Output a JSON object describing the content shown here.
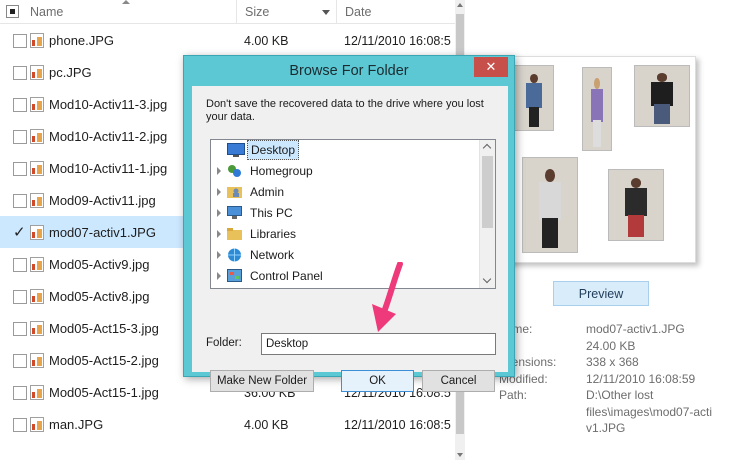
{
  "file_list": {
    "headers": {
      "name": "Name",
      "size": "Size",
      "date": "Date"
    },
    "rows": [
      {
        "name": "phone.JPG",
        "size": "4.00 KB",
        "date": "12/11/2010 16:08:5",
        "checked": false
      },
      {
        "name": "pc.JPG",
        "size": "",
        "date": "",
        "checked": false
      },
      {
        "name": "Mod10-Activ11-3.jpg",
        "size": "",
        "date": "",
        "checked": false
      },
      {
        "name": "Mod10-Activ11-2.jpg",
        "size": "",
        "date": "",
        "checked": false
      },
      {
        "name": "Mod10-Activ11-1.jpg",
        "size": "",
        "date": "",
        "checked": false
      },
      {
        "name": "Mod09-Activ11.jpg",
        "size": "",
        "date": "",
        "checked": false
      },
      {
        "name": "mod07-activ1.JPG",
        "size": "",
        "date": "",
        "checked": true
      },
      {
        "name": "Mod05-Activ9.jpg",
        "size": "",
        "date": "",
        "checked": false
      },
      {
        "name": "Mod05-Activ8.jpg",
        "size": "",
        "date": "",
        "checked": false
      },
      {
        "name": "Mod05-Act15-3.jpg",
        "size": "",
        "date": "",
        "checked": false
      },
      {
        "name": "Mod05-Act15-2.jpg",
        "size": "",
        "date": "",
        "checked": false
      },
      {
        "name": "Mod05-Act15-1.jpg",
        "size": "36.00 KB",
        "date": "12/11/2010 16:08:5",
        "checked": false
      },
      {
        "name": "man.JPG",
        "size": "4.00 KB",
        "date": "12/11/2010 16:08:5",
        "checked": false
      }
    ]
  },
  "preview": {
    "button_label": "Preview",
    "properties": [
      {
        "label": "name:",
        "value": "mod07-activ1.JPG"
      },
      {
        "label": "e:",
        "value": "24.00 KB"
      },
      {
        "label": "imensions:",
        "value": "338 x 368"
      },
      {
        "label": "Modified:",
        "value": "12/11/2010 16:08:59"
      },
      {
        "label": "Path:",
        "value": "D:\\Other lost"
      },
      {
        "label": "",
        "value": "files\\images\\mod07-acti"
      },
      {
        "label": "",
        "value": "v1.JPG"
      }
    ]
  },
  "dialog": {
    "title": "Browse For Folder",
    "close_glyph": "✕",
    "message": "Don't save the recovered data to the drive where you lost your data.",
    "tree_items": [
      {
        "label": "Desktop",
        "icon": "desktop-icon",
        "selected": true,
        "expandable": false
      },
      {
        "label": "Homegroup",
        "icon": "homegroup-icon",
        "selected": false,
        "expandable": true
      },
      {
        "label": "Admin",
        "icon": "user-folder-icon",
        "selected": false,
        "expandable": true
      },
      {
        "label": "This PC",
        "icon": "computer-icon",
        "selected": false,
        "expandable": true
      },
      {
        "label": "Libraries",
        "icon": "libraries-icon",
        "selected": false,
        "expandable": true
      },
      {
        "label": "Network",
        "icon": "network-icon",
        "selected": false,
        "expandable": true
      },
      {
        "label": "Control Panel",
        "icon": "control-panel-icon",
        "selected": false,
        "expandable": true
      }
    ],
    "folder_label": "Folder:",
    "folder_value": "Desktop",
    "buttons": {
      "make_new_folder": "Make New Folder",
      "ok": "OK",
      "cancel": "Cancel"
    }
  },
  "colors": {
    "dialog_frame": "#5cc8d4",
    "close_button": "#c7504a",
    "selection": "#cce8ff",
    "annotation_arrow": "#ee3a7a"
  }
}
